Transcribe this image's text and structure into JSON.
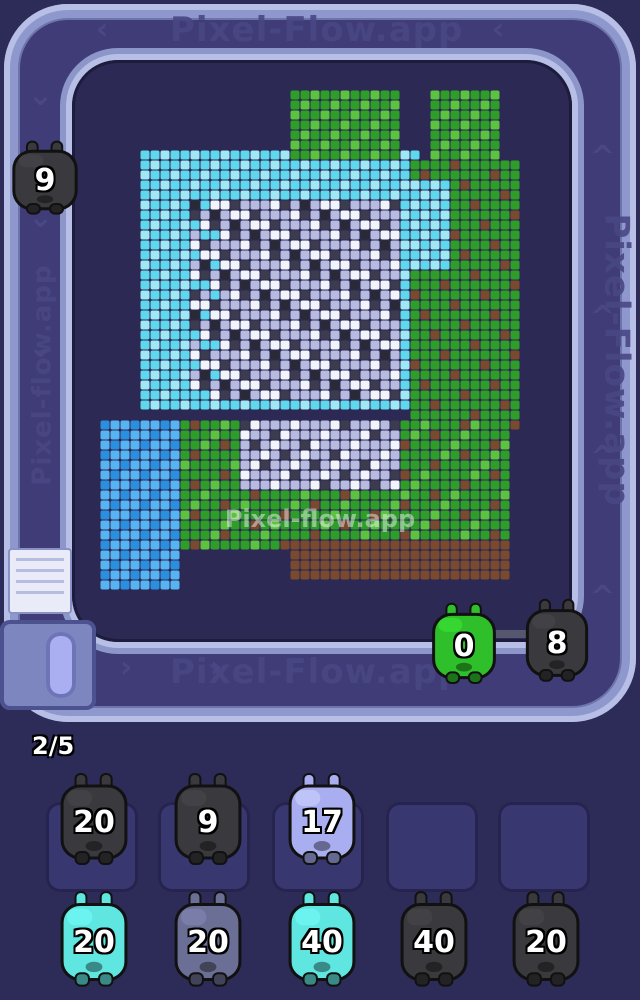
{
  "watermarks": {
    "belt_top": "Pixel-Flow.app",
    "belt_bottom": "Pixel-Flow.app",
    "belt_right": "Pixel-Flow.app",
    "belt_left": "Pixel-flow.app",
    "center": "Pixel-flow.app"
  },
  "colors": {
    "background": "#2d2b57",
    "pig_black": "#3a3a3e",
    "pig_green": "#2fbf2a",
    "pig_cyan": "#5fe6e0",
    "pig_lavender": "#a9aef0",
    "pig_grey": "#6c6f95"
  },
  "belt_pigs": [
    {
      "count": "9",
      "color": "black"
    },
    {
      "count": "0",
      "color": "green"
    },
    {
      "count": "8",
      "color": "black"
    }
  ],
  "queue": {
    "label": "2/5"
  },
  "slots_row": [
    {
      "count": "20",
      "color": "black"
    },
    {
      "count": "9",
      "color": "black"
    },
    {
      "count": "17",
      "color": "lavender"
    },
    {
      "count": "",
      "color": "empty"
    },
    {
      "count": "",
      "color": "empty"
    }
  ],
  "bottom_row": [
    {
      "count": "20",
      "color": "cyan"
    },
    {
      "count": "20",
      "color": "grey"
    },
    {
      "count": "40",
      "color": "cyan"
    },
    {
      "count": "40",
      "color": "black"
    },
    {
      "count": "20",
      "color": "black"
    }
  ]
}
